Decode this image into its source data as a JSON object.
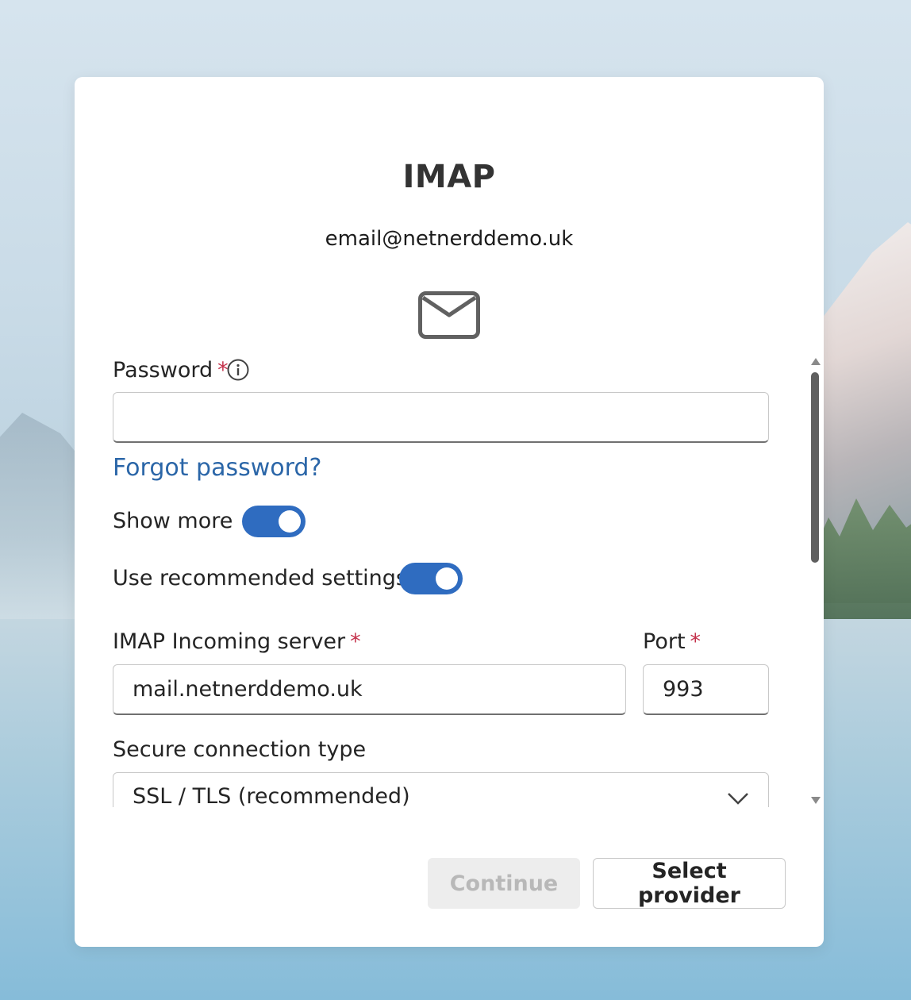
{
  "dialog": {
    "title": "IMAP",
    "email": "email@netnerddemo.uk",
    "icon": "mail-icon"
  },
  "form": {
    "password": {
      "label": "Password",
      "required": "*",
      "value": "",
      "info_icon": "info-icon"
    },
    "forgot_password": "Forgot password?",
    "show_more": {
      "label": "Show more",
      "on": true
    },
    "use_recommended": {
      "label": "Use recommended settings",
      "on": true
    },
    "imap_server": {
      "label": "IMAP Incoming server",
      "required": "*",
      "value": "mail.netnerddemo.uk"
    },
    "port": {
      "label": "Port",
      "required": "*",
      "value": "993"
    },
    "secure_connection": {
      "label": "Secure connection type",
      "value": "SSL / TLS (recommended)",
      "icon": "chevron-down-icon"
    }
  },
  "actions": {
    "continue": "Continue",
    "select_provider": "Select provider"
  },
  "colors": {
    "accent": "#2f6cc0",
    "link": "#2b66a8",
    "required": "#c4314b"
  }
}
